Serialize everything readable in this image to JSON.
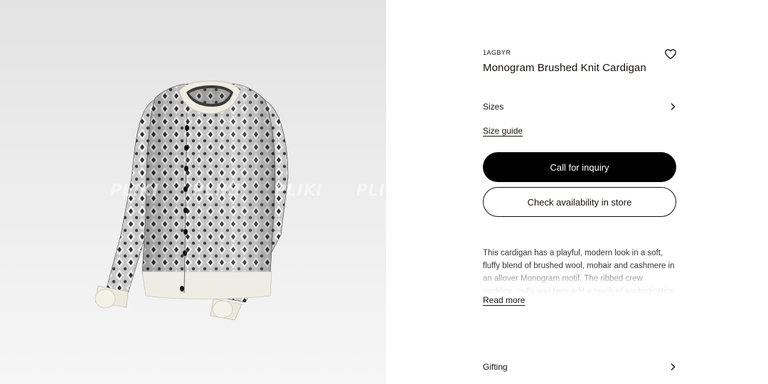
{
  "product": {
    "sku": "1AGBYR",
    "title": "Monogram Brushed Knit Cardigan",
    "image_alt": "cardigan-product-image"
  },
  "watermark": {
    "text": "PLIKI PLIKI PLIKI PLIKI PLIKI"
  },
  "wishlist": {
    "icon": "heart-outline-icon"
  },
  "sizes": {
    "label": "Sizes",
    "icon": "chevron-right-icon"
  },
  "size_guide": {
    "label": "Size guide"
  },
  "buttons": {
    "primary": "Call for inquiry",
    "secondary": "Check availability in store"
  },
  "description": {
    "text": "This cardigan has a playful, modern look in a soft, fluffy blend of brushed wool, mohair and cashmere in an allover Monogram motif. The ribbed crew neckline, cuffs and hem add a touch of sophistication to this seasonal piece.",
    "read_more": "Read more"
  },
  "gifting": {
    "label": "Gifting",
    "icon": "chevron-right-icon"
  },
  "colors": {
    "text": "#19110b",
    "button_bg": "#000000",
    "button_text": "#ffffff",
    "image_bg": "#ececec"
  }
}
